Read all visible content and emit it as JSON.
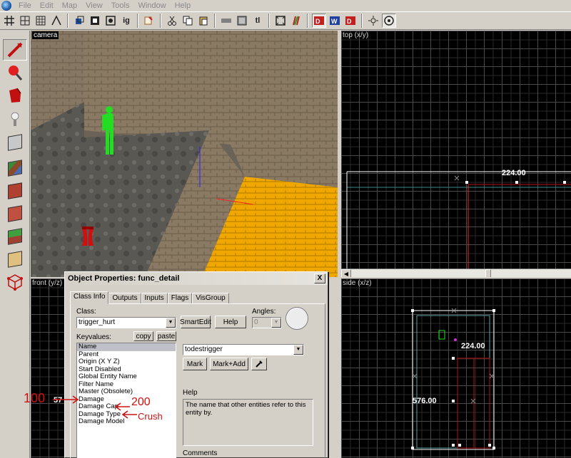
{
  "menu": [
    "File",
    "Edit",
    "Map",
    "View",
    "Tools",
    "Window",
    "Help"
  ],
  "toolbar": {
    "items": [
      "grid-icon",
      "grid-fine-icon",
      "grid-big-icon",
      "snap-icon",
      "3d-grid-icon",
      "square-icon",
      "circle-icon",
      "hide-icon",
      "ig",
      "selection-icon",
      "cut-icon",
      "copy-icon",
      "paste-icon",
      "flat-icon",
      "hand-icon",
      "tl",
      "texture-icon",
      "run-icon",
      "cordon-icon",
      "carve-icon",
      "hollow-icon"
    ],
    "ig_label": "ig",
    "tl_label": "tl"
  },
  "viewports": {
    "camera": "camera",
    "top": "top (x/y)",
    "front": "front (y/z)",
    "side": "side (x/z)"
  },
  "dims": {
    "top_width": "224.00",
    "side_width": "224.00",
    "side_height": "576.00",
    "front_partial": "57"
  },
  "dialog": {
    "title": "Object Properties: func_detail",
    "close": "X",
    "tabs": [
      "Class Info",
      "Outputs",
      "Inputs",
      "Flags",
      "VisGroup"
    ],
    "class_label": "Class:",
    "class_value": "trigger_hurt",
    "smartedit": "SmartEdit",
    "help_button": "Help",
    "angles_label": "Angles:",
    "angles_value": "0",
    "keyvalues_label": "Keyvalues:",
    "copy": "copy",
    "paste": "paste",
    "keyvalues": [
      "Name",
      "Parent",
      "Origin (X Y Z)",
      "Start Disabled",
      "Global Entity Name",
      "Filter Name",
      "Master (Obsolete)",
      "Damage",
      "Damage Cap",
      "Damage Type",
      "Damage Model"
    ],
    "value_field": "todestrigger",
    "mark": "Mark",
    "mark_add": "Mark+Add",
    "help_label": "Help",
    "help_text": "The name that other entities refer to this entity by.",
    "comments_label": "Comments"
  },
  "annotations": {
    "damage": "100",
    "damage_cap": "200",
    "damage_type": "Crush"
  },
  "colors": {
    "grid": "#4a4a4a",
    "selection": "#ffffff",
    "brush_red": "#b41414",
    "floor_orange": "#f0a800",
    "annotation_red": "#d01010",
    "player_green": "#22dd22"
  }
}
